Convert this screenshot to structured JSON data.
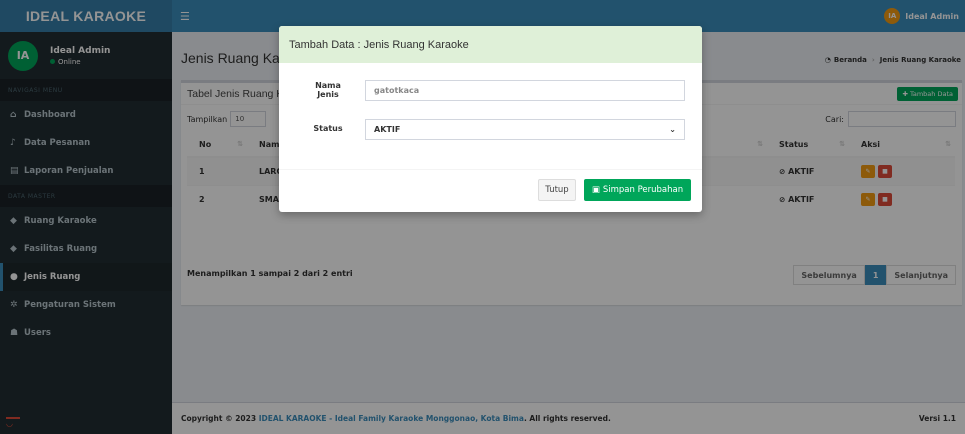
{
  "brand": "IDEAL KARAOKE",
  "user": {
    "initials": "IA",
    "name": "Ideal Admin",
    "status": "Online"
  },
  "sidebar": {
    "sections": [
      "NAVIGASI MENU",
      "DATA MASTER"
    ],
    "main_items": [
      {
        "label": "Dashboard",
        "icon": "home-icon"
      },
      {
        "label": "Data Pesanan",
        "icon": "bell-icon"
      },
      {
        "label": "Laporan Penjualan",
        "icon": "document-icon"
      }
    ],
    "master_items": [
      {
        "label": "Ruang Karaoke",
        "icon": "tag-icon"
      },
      {
        "label": "Fasilitas Ruang",
        "icon": "tag-icon"
      },
      {
        "label": "Jenis Ruang",
        "icon": "info-icon"
      },
      {
        "label": "Pengaturan Sistem",
        "icon": "gear-icon"
      },
      {
        "label": "Users",
        "icon": "users-icon"
      }
    ]
  },
  "topbar": {
    "user_name": "Ideal Admin"
  },
  "page": {
    "title": "Jenis Ruang Karaoke",
    "breadcrumb": [
      "Beranda",
      "Jenis Ruang Karaoke"
    ]
  },
  "box": {
    "title": "Tabel Jenis Ruang Karaoke",
    "add_button": "Tambah Data",
    "length_label": "Tampilkan",
    "length_value": "10",
    "search_label": "Cari:",
    "columns": [
      "No",
      "Nama Jenis",
      "Status",
      "Aksi"
    ],
    "rows": [
      {
        "no": "1",
        "name": "LARGE",
        "status": "AKTIF"
      },
      {
        "no": "2",
        "name": "SMALL",
        "status": "AKTIF"
      }
    ],
    "info": "Menampilkan 1 sampai 2 dari 2 entri",
    "pager": {
      "prev": "Sebelumnya",
      "current": "1",
      "next": "Selanjutnya"
    }
  },
  "footer": {
    "prefix": "Copyright © 2023 ",
    "brand": "IDEAL KARAOKE - Ideal Family Karaoke Monggonao, Kota Bima",
    "suffix": ". All rights reserved.",
    "version": "Versi 1.1"
  },
  "modal": {
    "title": "Tambah Data : Jenis Ruang Karaoke",
    "name_label": "Nama Jenis",
    "name_placeholder": "gatotkaca",
    "status_label": "Status",
    "status_value": "AKTIF",
    "close_button": "Tutup",
    "save_button": "Simpan Perubahan"
  },
  "colors": {
    "primary": "#3c8dbc",
    "success": "#00a65a",
    "sidebar": "#222d32",
    "warning": "#f39c12",
    "danger": "#dd4b39",
    "modal_header": "#dff0d8"
  }
}
